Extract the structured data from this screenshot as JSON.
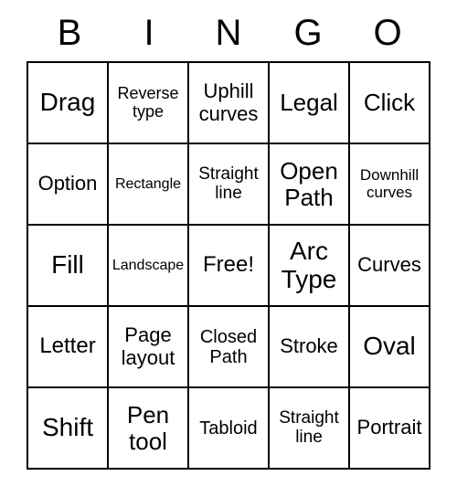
{
  "header": [
    "B",
    "I",
    "N",
    "G",
    "O"
  ],
  "grid": [
    [
      {
        "text": "Drag",
        "size": "fs-28"
      },
      {
        "text": "Reverse type",
        "size": "fs-18"
      },
      {
        "text": "Uphill curves",
        "size": "fs-22"
      },
      {
        "text": "Legal",
        "size": "fs-26"
      },
      {
        "text": "Click",
        "size": "fs-26"
      }
    ],
    [
      {
        "text": "Option",
        "size": "fs-22"
      },
      {
        "text": "Rectangle",
        "size": "fs-16"
      },
      {
        "text": "Straight line",
        "size": "fs-19"
      },
      {
        "text": "Open Path",
        "size": "fs-26"
      },
      {
        "text": "Downhill curves",
        "size": "fs-17"
      }
    ],
    [
      {
        "text": "Fill",
        "size": "fs-28"
      },
      {
        "text": "Landscape",
        "size": "fs-16"
      },
      {
        "text": "Free!",
        "size": "fs-24"
      },
      {
        "text": "Arc Type",
        "size": "fs-28"
      },
      {
        "text": "Curves",
        "size": "fs-22"
      }
    ],
    [
      {
        "text": "Letter",
        "size": "fs-24"
      },
      {
        "text": "Page layout",
        "size": "fs-22"
      },
      {
        "text": "Closed Path",
        "size": "fs-20"
      },
      {
        "text": "Stroke",
        "size": "fs-22"
      },
      {
        "text": "Oval",
        "size": "fs-28"
      }
    ],
    [
      {
        "text": "Shift",
        "size": "fs-28"
      },
      {
        "text": "Pen tool",
        "size": "fs-26"
      },
      {
        "text": "Tabloid",
        "size": "fs-20"
      },
      {
        "text": "Straight line",
        "size": "fs-19"
      },
      {
        "text": "Portrait",
        "size": "fs-22"
      }
    ]
  ]
}
